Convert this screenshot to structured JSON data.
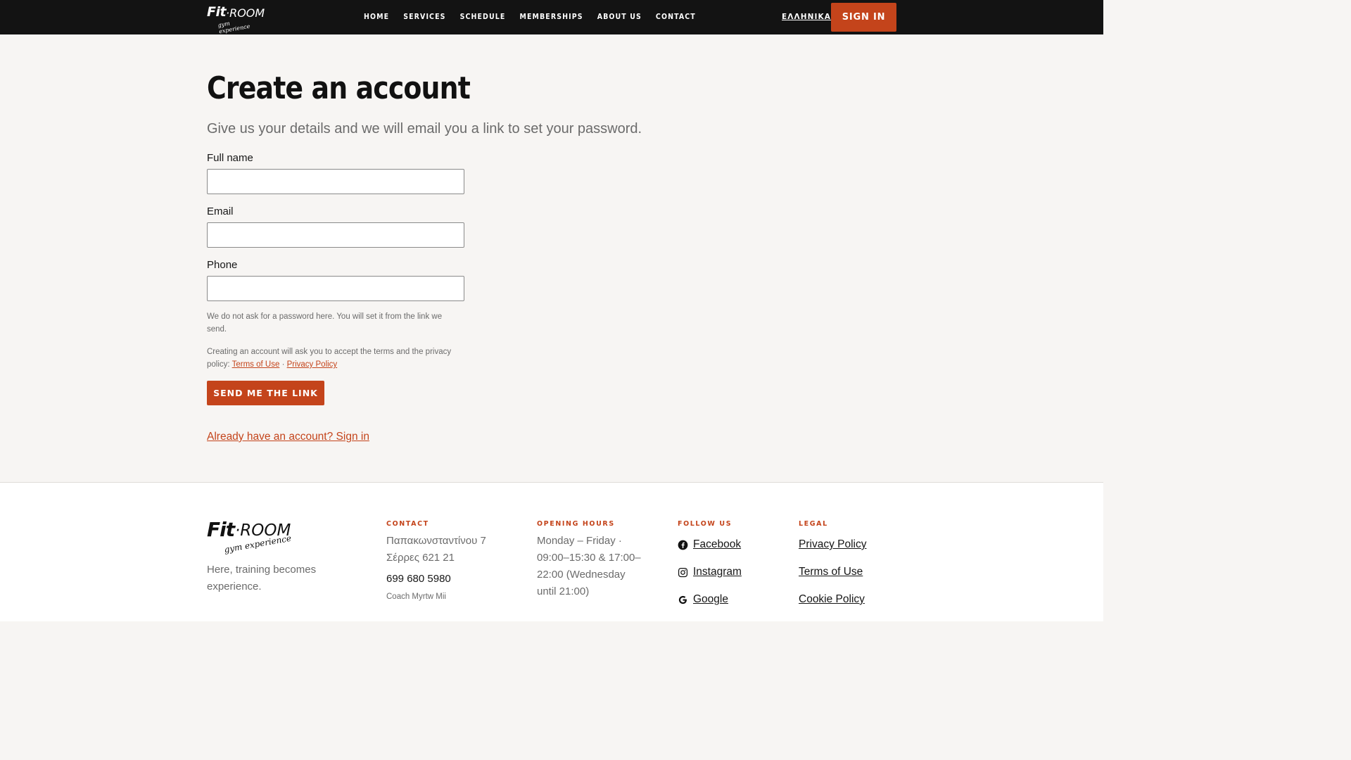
{
  "header": {
    "logo_main": "Fit",
    "logo_room": "·ROOM",
    "logo_tag": "gym experience",
    "nav": [
      "HOME",
      "SERVICES",
      "SCHEDULE",
      "MEMBERSHIPS",
      "ABOUT US",
      "CONTACT"
    ],
    "language": "ΕΛΛΗΝΙΚΑ",
    "signin_label": "SIGN IN"
  },
  "main": {
    "title": "Create an account",
    "subtitle": "Give us your details and we will email you a link to set your password.",
    "fields": {
      "full_name": {
        "label": "Full name",
        "value": ""
      },
      "email": {
        "label": "Email",
        "value": ""
      },
      "phone": {
        "label": "Phone",
        "value": ""
      }
    },
    "password_note": "We do not ask for a password here. You will set it from the link we send.",
    "terms_note": "Creating an account will ask you to accept the terms and the privacy policy:",
    "terms_link": "Terms of Use",
    "separator": "·",
    "privacy_link": "Privacy Policy",
    "send_label": "SEND ME THE LINK",
    "already_label": "Already have an account? Sign in"
  },
  "footer": {
    "logo_main": "Fit",
    "logo_room": "·ROOM",
    "logo_tag": "gym experience",
    "tagline": "Here, training becomes experience.",
    "contact": {
      "heading": "CONTACT",
      "address_line1": "Παπακωνσταντίνου 7",
      "address_line2": "Σέρρες 621 21",
      "phone": "699 680 5980",
      "coach": "Coach Myrtw Mii"
    },
    "hours": {
      "heading": "OPENING HOURS",
      "text": "Monday – Friday · 09:00–15:30 & 17:00–22:00 (Wednesday until 21:00)"
    },
    "follow": {
      "heading": "FOLLOW US",
      "items": [
        {
          "label": "Facebook",
          "icon": "facebook-icon"
        },
        {
          "label": "Instagram",
          "icon": "instagram-icon"
        },
        {
          "label": "Google",
          "icon": "google-icon"
        }
      ]
    },
    "legal": {
      "heading": "LEGAL",
      "items": [
        "Privacy Policy",
        "Terms of Use",
        "Cookie Policy"
      ]
    }
  },
  "colors": {
    "accent": "#c4441b",
    "header_bg": "#131313",
    "page_bg": "#f7f5f3"
  }
}
